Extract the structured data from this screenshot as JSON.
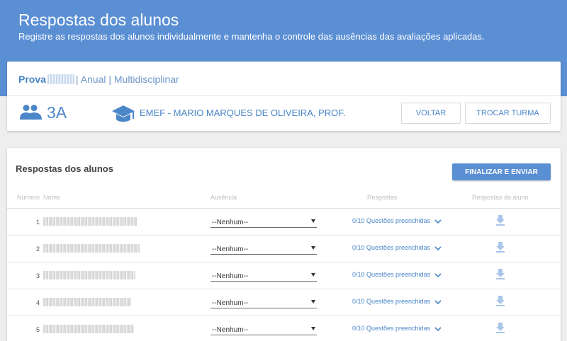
{
  "header": {
    "title": "Respostas dos alunos",
    "subtitle": "Registre as respostas dos alunos individualmente e mantenha o controle das ausências das avaliações aplicadas."
  },
  "exam": {
    "prefix": "Prova",
    "suffix": "| Anual | Multidisciplinar"
  },
  "class": {
    "name": "3A",
    "school": "EMEF - MARIO MARQUES DE OLIVEIRA, PROF.",
    "back_label": "VOLTAR",
    "change_label": "TROCAR TURMA"
  },
  "answers": {
    "title": "Respostas dos alunos",
    "finalize_label": "FINALIZAR E ENVIAR",
    "columns": [
      "Número",
      "Nome",
      "Ausência",
      "Respostas",
      "Respostas do aluno"
    ],
    "rows": [
      {
        "number": "1",
        "absence": "--Nenhum--",
        "responses": "0/10 Questões preenchidas"
      },
      {
        "number": "2",
        "absence": "--Nenhum--",
        "responses": "0/10 Questões preenchidas"
      },
      {
        "number": "3",
        "absence": "--Nenhum--",
        "responses": "0/10 Questões preenchidas"
      },
      {
        "number": "4",
        "absence": "--Nenhum--",
        "responses": "0/10 Questões preenchidas"
      },
      {
        "number": "5",
        "absence": "--Nenhum--",
        "responses": "0/10 Questões preenchidas"
      }
    ]
  },
  "colors": {
    "brand": "#5b8fd4",
    "link": "#4a86c8"
  },
  "icons": {
    "class": "group-icon",
    "school": "graduation-cap-icon",
    "expand": "chevron-down-icon",
    "download": "download-icon"
  }
}
